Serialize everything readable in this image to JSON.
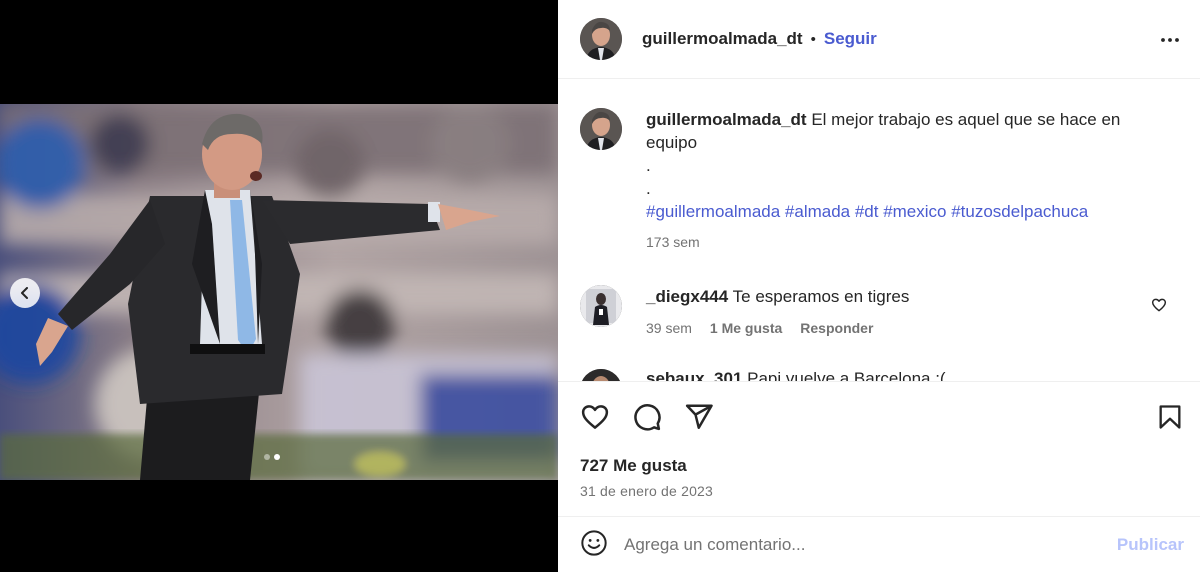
{
  "post": {
    "username": "guillermoalmada_dt",
    "separator": "•",
    "follow_label": "Seguir",
    "more_options_icon": "more-horizontal-icon"
  },
  "caption": {
    "username": "guillermoalmada_dt",
    "text": "El mejor trabajo es aquel que se hace en equipo",
    "line_dot_1": ".",
    "line_dot_2": ".",
    "hashtags": "#guillermoalmada #almada #dt #mexico #tuzosdelpachuca",
    "time": "173 sem"
  },
  "comments": [
    {
      "username": "_diegx444",
      "text": "Te esperamos en tigres",
      "time": "39 sem",
      "likes": "1 Me gusta",
      "reply_label": "Responder"
    },
    {
      "username": "sebaux_301",
      "text": "Papi vuelve a Barcelona :("
    }
  ],
  "stats": {
    "likes": "727 Me gusta",
    "date": "31 de enero de 2023"
  },
  "composer": {
    "placeholder": "Agrega un comentario...",
    "publish_label": "Publicar"
  },
  "colors": {
    "link_blue": "#4a5bd0",
    "publish_disabled": "#b7c4fb",
    "meta_gray": "#737373",
    "text": "#262626"
  }
}
